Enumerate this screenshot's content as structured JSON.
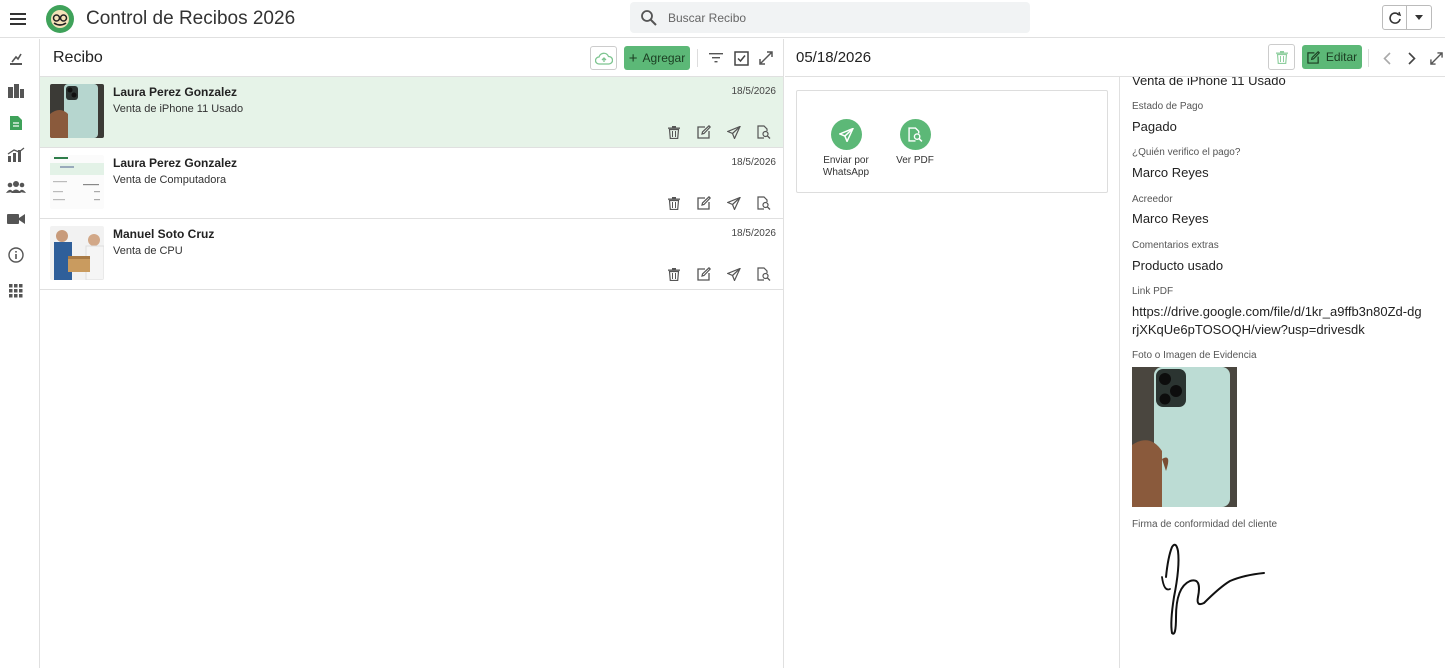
{
  "app": {
    "title": "Control de Recibos 2026"
  },
  "search": {
    "placeholder": "Buscar Recibo"
  },
  "colors": {
    "accent": "#5cb877",
    "selected_row": "#e6f3e8"
  },
  "nav": [
    "menu-icon",
    "chart-tools-icon",
    "building-icon",
    "document-icon",
    "analytics-icon",
    "people-icon",
    "video-icon",
    "info-icon",
    "apps-icon"
  ],
  "list": {
    "title": "Recibo",
    "add_label": "Agregar",
    "items": [
      {
        "name": "Laura Perez Gonzalez",
        "desc": "Venta de iPhone 11 Usado",
        "date": "18/5/2026"
      },
      {
        "name": "Laura Perez Gonzalez",
        "desc": "Venta de Computadora",
        "date": "18/5/2026"
      },
      {
        "name": "Manuel Soto Cruz",
        "desc": "Venta de CPU",
        "date": "18/5/2026"
      }
    ]
  },
  "detail": {
    "date": "05/18/2026",
    "edit_label": "Editar",
    "actions": {
      "whatsapp_label": "Enviar por WhatsApp",
      "pdf_label": "Ver PDF"
    },
    "top_value": "Venta de iPhone 11 Usado",
    "fields": [
      {
        "label": "Estado de Pago",
        "value": "Pagado"
      },
      {
        "label": "¿Quién verifico el pago?",
        "value": "Marco Reyes"
      },
      {
        "label": "Acreedor",
        "value": "Marco Reyes"
      },
      {
        "label": "Comentarios extras",
        "value": "Producto usado"
      },
      {
        "label": "Link PDF",
        "value": "https://drive.google.com/file/d/1kr_a9ffb3n80Zd-dgrjXKqUe6pTOSOQH/view?usp=drivesdk"
      }
    ],
    "evidence_label": "Foto o Imagen de Evidencia",
    "signature_label": "Firma de conformidad del cliente"
  }
}
